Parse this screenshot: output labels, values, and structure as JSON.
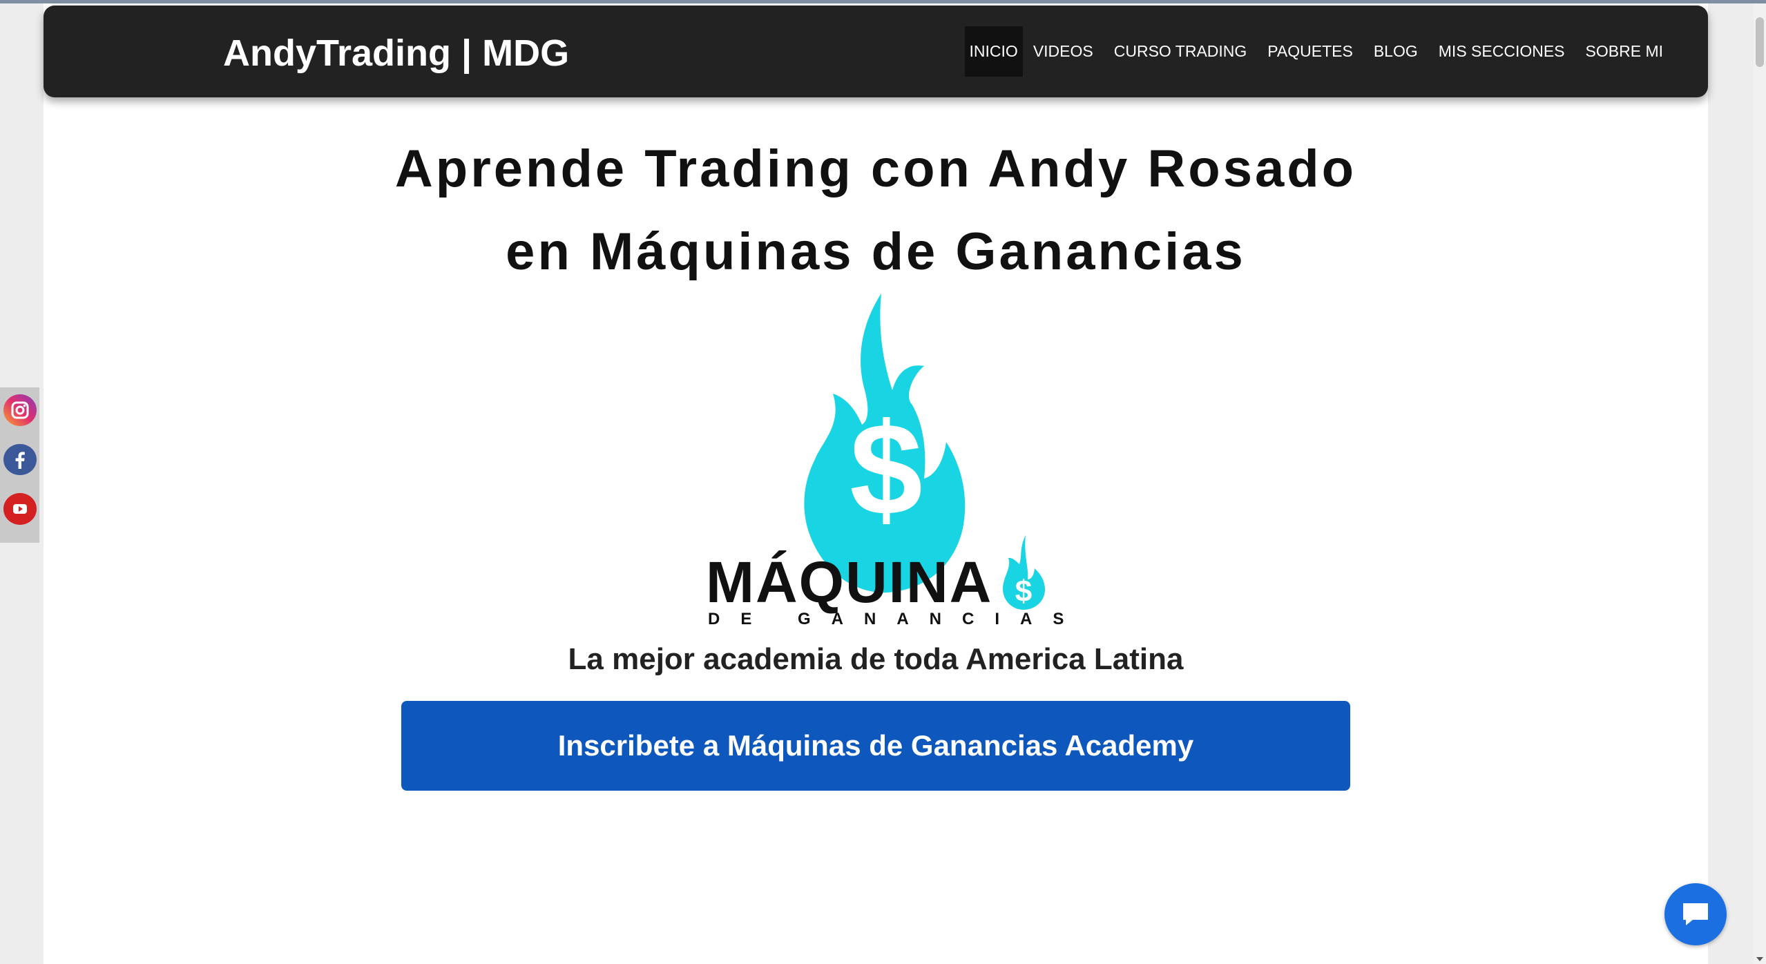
{
  "brand": {
    "title": "AndyTrading | MDG"
  },
  "nav": {
    "items": [
      {
        "label": "INICIO",
        "active": true
      },
      {
        "label": "VIDEOS"
      },
      {
        "label": "CURSO TRADING"
      },
      {
        "label": "PAQUETES"
      },
      {
        "label": "BLOG"
      },
      {
        "label": "MIS SECCIONES"
      },
      {
        "label": "SOBRE MI"
      }
    ]
  },
  "hero": {
    "headline_line1": "Aprende Trading con Andy Rosado",
    "headline_line2": "en Máquinas de Ganancias",
    "logo_word": "MÁQUINA",
    "logo_sub": "DE GANANCIAS",
    "tagline": "La mejor academia de toda America Latina",
    "cta_label": "Inscribete a Máquinas de Ganancias Academy"
  },
  "social": {
    "icons": [
      "instagram-icon",
      "facebook-icon",
      "youtube-icon"
    ]
  },
  "colors": {
    "navbar": "#222222",
    "flame": "#19d5e3",
    "cta": "#0d57bd",
    "chat": "#1c6fe0"
  }
}
